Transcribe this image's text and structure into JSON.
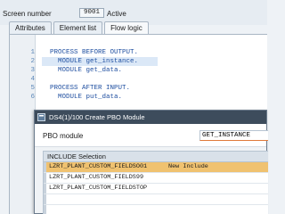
{
  "screen": {
    "label": "Screen number",
    "number": "9001",
    "status": "Active"
  },
  "tabs": [
    {
      "label": "Attributes"
    },
    {
      "label": "Element list"
    },
    {
      "label": "Flow logic"
    }
  ],
  "code_lines": [
    {
      "num": "1",
      "text": "  PROCESS BEFORE OUTPUT."
    },
    {
      "num": "2",
      "text": "    MODULE get_instance."
    },
    {
      "num": "3",
      "text": "    MODULE get_data."
    },
    {
      "num": "4",
      "text": ""
    },
    {
      "num": "5",
      "text": "  PROCESS AFTER INPUT."
    },
    {
      "num": "6",
      "text": "    MODULE put_data."
    }
  ],
  "dialog": {
    "title": "DS4(1)/100 Create PBO Module",
    "pbo_label": "PBO module",
    "pbo_value": "GET_INSTANCE",
    "include_header": "INCLUDE Selection",
    "includes": [
      {
        "name": "LZRT_PLANT_CUSTOM_FIELDSO01",
        "desc": "New Include"
      },
      {
        "name": "LZRT_PLANT_CUSTOM_FIELDS99",
        "desc": ""
      },
      {
        "name": "LZRT_PLANT_CUSTOM_FIELDSTOP",
        "desc": ""
      }
    ]
  },
  "colors": {
    "selected_row": "#f0c270",
    "dialog_title_bg": "#3d4c5c",
    "code_keyword": "#1f4fa0"
  }
}
